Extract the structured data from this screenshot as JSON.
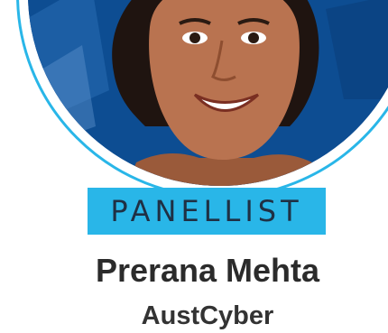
{
  "badge": {
    "label": "PANELLIST"
  },
  "person": {
    "name": "Prerana Mehta",
    "organisation": "AustCyber"
  },
  "colors": {
    "accent": "#29b6e8",
    "photo_background": "#0d4d92",
    "name_text": "#2b2b2b"
  }
}
